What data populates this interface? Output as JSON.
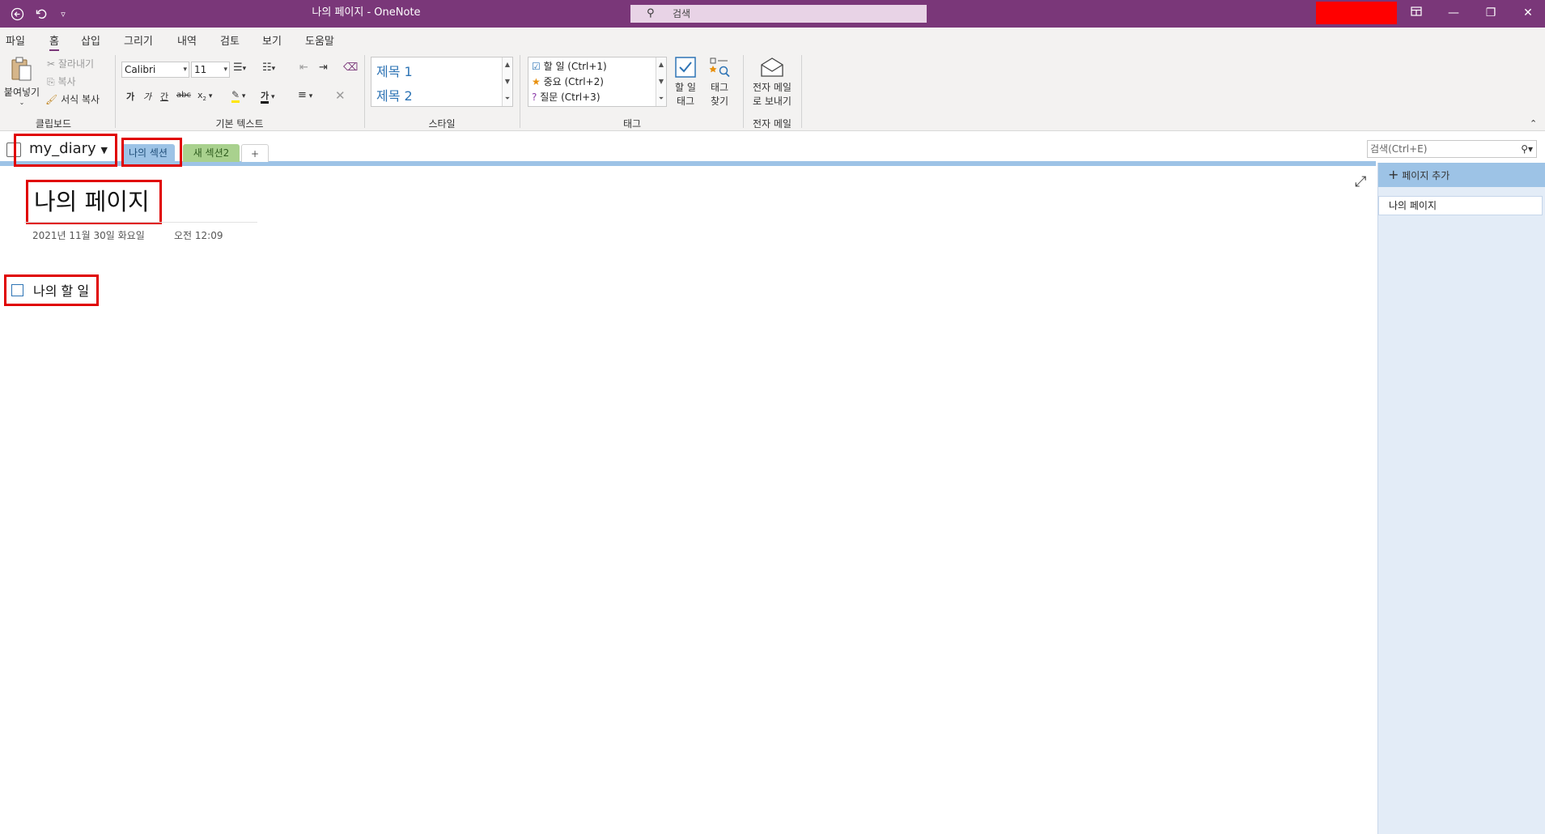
{
  "titlebar": {
    "title": "나의 페이지  -  OneNote",
    "search_placeholder": "검색",
    "back_icon": "back-arrow-icon",
    "undo_icon": "undo-icon",
    "qat_icon": "customize-qat-icon"
  },
  "menu": {
    "tabs": [
      "파일",
      "홈",
      "삽입",
      "그리기",
      "내역",
      "검토",
      "보기",
      "도움말"
    ],
    "active": "홈"
  },
  "ribbon": {
    "clipboard": {
      "paste": "붙여넣기",
      "cut": "잘라내기",
      "copy": "복사",
      "format_painter": "서식 복사",
      "label": "클립보드"
    },
    "basic_text": {
      "font": "Calibri",
      "size": "11",
      "bold": "가",
      "italic": "가",
      "underline": "간",
      "strike": "abc",
      "subscript": "x",
      "font_color_glyph": "가",
      "label": "기본 텍스트"
    },
    "styles": {
      "heading1": "제목 1",
      "heading2": "제목 2",
      "label": "스타일"
    },
    "tags": {
      "todo": "할 일 (Ctrl+1)",
      "important": "중요 (Ctrl+2)",
      "question": "질문 (Ctrl+3)",
      "todo_tag_btn": "할 일",
      "todo_tag_btn2": "태그",
      "find_tags_btn": "태그",
      "find_tags_btn2": "찾기",
      "label": "태그"
    },
    "email": {
      "send_btn": "전자 메일",
      "send_btn2": "로 보내기",
      "label": "전자 메일"
    }
  },
  "notebook": {
    "name": "my_diary",
    "sections": [
      {
        "label": "나의 섹션",
        "color": "#9dc3e6"
      },
      {
        "label": "새 섹션2",
        "color": "#a9d18e"
      }
    ],
    "add_section": "+",
    "search_placeholder": "검색(Ctrl+E)"
  },
  "page": {
    "title": "나의 페이지",
    "date": "2021년 11월 30일 화요일",
    "time": "오전 12:09",
    "todo_item": "나의 할 일"
  },
  "pages_pane": {
    "add_page": "페이지 추가",
    "pages": [
      "나의 페이지"
    ]
  },
  "colors": {
    "accent": "#7a3779",
    "highlight_box": "#e00000",
    "section_blue": "#9dc3e6",
    "section_green": "#a9d18e"
  }
}
